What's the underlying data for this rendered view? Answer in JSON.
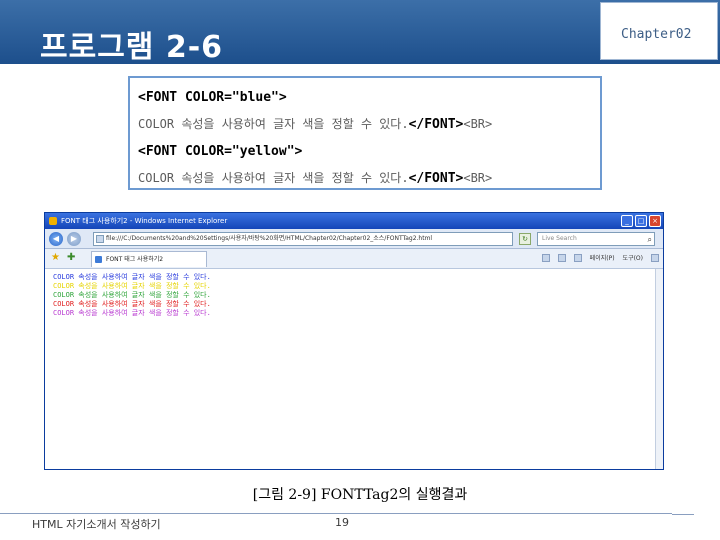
{
  "header": {
    "title": "프로그램 2-6",
    "chapter": "Chapter02"
  },
  "code": {
    "line1": "<FONT COLOR=\"blue\">",
    "line2_text": "COLOR 속성을 사용하여 글자 색을 정할 수 있다.",
    "line2_tag": "</FONT>",
    "line2_br": "<BR>",
    "line3": "<FONT COLOR=\"yellow\">",
    "line4_text": "COLOR 속성을 사용하여 글자 색을 정할 수 있다.",
    "line4_tag": "</FONT>",
    "line4_br": "<BR>"
  },
  "browser": {
    "title": "FONT 태그 사용하기2 - Windows Internet Explorer",
    "address": "file:///C:/Documents%20and%20Settings/사용자/바탕%20화면/HTML/Chapter02/Chapter02_소스/FONTTag2.html",
    "search_placeholder": "Live Search",
    "tab_label": "FONT 태그 사용하기2",
    "cmd_page": "페이지(P)",
    "cmd_tools": "도구(O)",
    "page_lines": [
      "COLOR 속성을 사용하여 글자 색을 정할 수 있다.",
      "COLOR 속성을 사용하여 글자 색을 정할 수 있다.",
      "COLOR 속성을 사용하여 글자 색을 정할 수 있다.",
      "COLOR 속성을 사용하여 글자 색을 정할 수 있다.",
      "COLOR 속성을 사용하여 글자 색을 정할 수 있다."
    ],
    "line_colors": [
      "#2a3cdd",
      "#e6d400",
      "#2fa43a",
      "#e02020",
      "#b83ad0"
    ]
  },
  "caption": "[그림 2-9] FONTTag2의 실행결과",
  "footer": {
    "left": "HTML 자기소개서 작성하기",
    "page": "19"
  },
  "colors": {
    "header": "#1d4f8c",
    "code_border": "#6d9ad1",
    "ie_title": "#1445b8"
  },
  "icons": [
    "back-icon",
    "forward-icon",
    "refresh-icon",
    "search-icon",
    "favorites-star-icon",
    "add-favorites-icon",
    "home-icon",
    "page-icon",
    "tools-icon",
    "minimize-icon",
    "maximize-icon",
    "close-icon"
  ]
}
